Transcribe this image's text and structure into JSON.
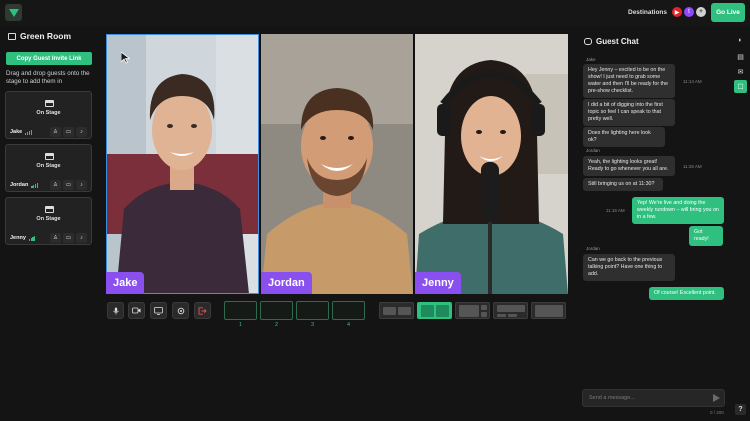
{
  "topbar": {
    "destinations_label": "Destinations",
    "go_live_label": "Go Live",
    "destination_icons": [
      "youtube-icon",
      "twitch-icon",
      "add-icon"
    ],
    "add_glyph": "+",
    "brand_green": "#2fbf7f"
  },
  "green_room": {
    "title": "Green Room",
    "invite_label": "Copy Guest Invite Link",
    "hint": "Drag and drop guests onto the stage to add them in",
    "guests": [
      {
        "name": "Jake",
        "status": "On Stage"
      },
      {
        "name": "Jordan",
        "status": "On Stage"
      },
      {
        "name": "Jenny",
        "status": "On Stage"
      }
    ]
  },
  "stage": {
    "tiles": [
      {
        "name": "Jake",
        "active": true
      },
      {
        "name": "Jordan",
        "active": false
      },
      {
        "name": "Jenny",
        "active": false
      }
    ],
    "name_tag_color": "#8a4fef",
    "controls": [
      "mic-icon",
      "camera-icon",
      "screen-share-icon",
      "settings-icon",
      "leave-icon"
    ],
    "slots": [
      "1",
      "2",
      "3",
      "4"
    ],
    "layouts": [
      "layout-split",
      "layout-grid-2",
      "layout-main-side",
      "layout-main-bottom",
      "layout-focus"
    ],
    "selected_layout": 1
  },
  "chat": {
    "title": "Guest Chat",
    "input_placeholder": "Send a message...",
    "char_count": "0 / 200",
    "messages": {
      "jenny_sender": "Jake",
      "m1": "Hey Jenny – excited to be on the show! I just need to grab some water and then I'll be ready for the pre-show checklist.",
      "m1_time": "11:14 AM",
      "m2": "I did a bit of digging into the first topic so feel I can speak to that pretty well.",
      "m3": "Does the lighting here look ok?",
      "jordan_sender": "Jordan",
      "m4": "Yeah, the lighting looks great! Ready to go whenever you all are.",
      "m4_time": "11:26 AM",
      "m5": "Still bringing us on at 11:30?",
      "m6_time": "11:16 AM",
      "m6": "Yep! We're live and doing the weekly rundown – will bring you on in a few.",
      "m7": "Got ready!",
      "jordan2_sender": "Jordan",
      "m8": "Can we go back to the previous talking point? Have one thing to add.",
      "m9": "Of course! Excellent point."
    }
  },
  "rail": {
    "icons": [
      "palette-icon",
      "media-icon",
      "alert-icon",
      "chat-icon"
    ],
    "help_label": "?"
  }
}
